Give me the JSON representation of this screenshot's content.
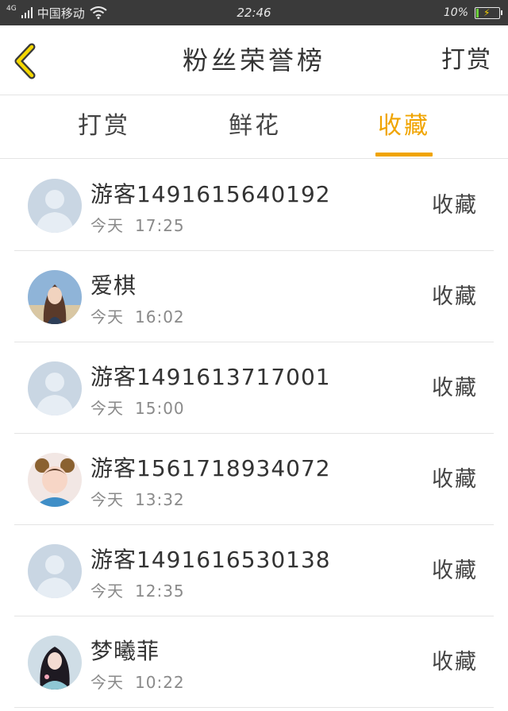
{
  "status_bar": {
    "network": "4G",
    "carrier": "中国移动",
    "time": "22:46",
    "battery_text": "10%",
    "battery_level": 0.1
  },
  "header": {
    "title": "粉丝荣誉榜",
    "action_label": "打赏"
  },
  "tabs": [
    {
      "label": "打赏"
    },
    {
      "label": "鲜花"
    },
    {
      "label": "收藏"
    }
  ],
  "active_tab": "收藏",
  "colors": {
    "accent": "#f0a400"
  },
  "list": [
    {
      "name": "游客1491615640192",
      "day": "今天",
      "time": "17:25",
      "action": "收藏",
      "avatar": "default"
    },
    {
      "name": "爱棋",
      "day": "今天",
      "time": "16:02",
      "action": "收藏",
      "avatar": "photo"
    },
    {
      "name": "游客1491613717001",
      "day": "今天",
      "time": "15:00",
      "action": "收藏",
      "avatar": "default"
    },
    {
      "name": "游客1561718934072",
      "day": "今天",
      "time": "13:32",
      "action": "收藏",
      "avatar": "photo"
    },
    {
      "name": "游客1491616530138",
      "day": "今天",
      "time": "12:35",
      "action": "收藏",
      "avatar": "default"
    },
    {
      "name": "梦曦菲",
      "day": "今天",
      "time": "10:22",
      "action": "收藏",
      "avatar": "photo"
    }
  ]
}
